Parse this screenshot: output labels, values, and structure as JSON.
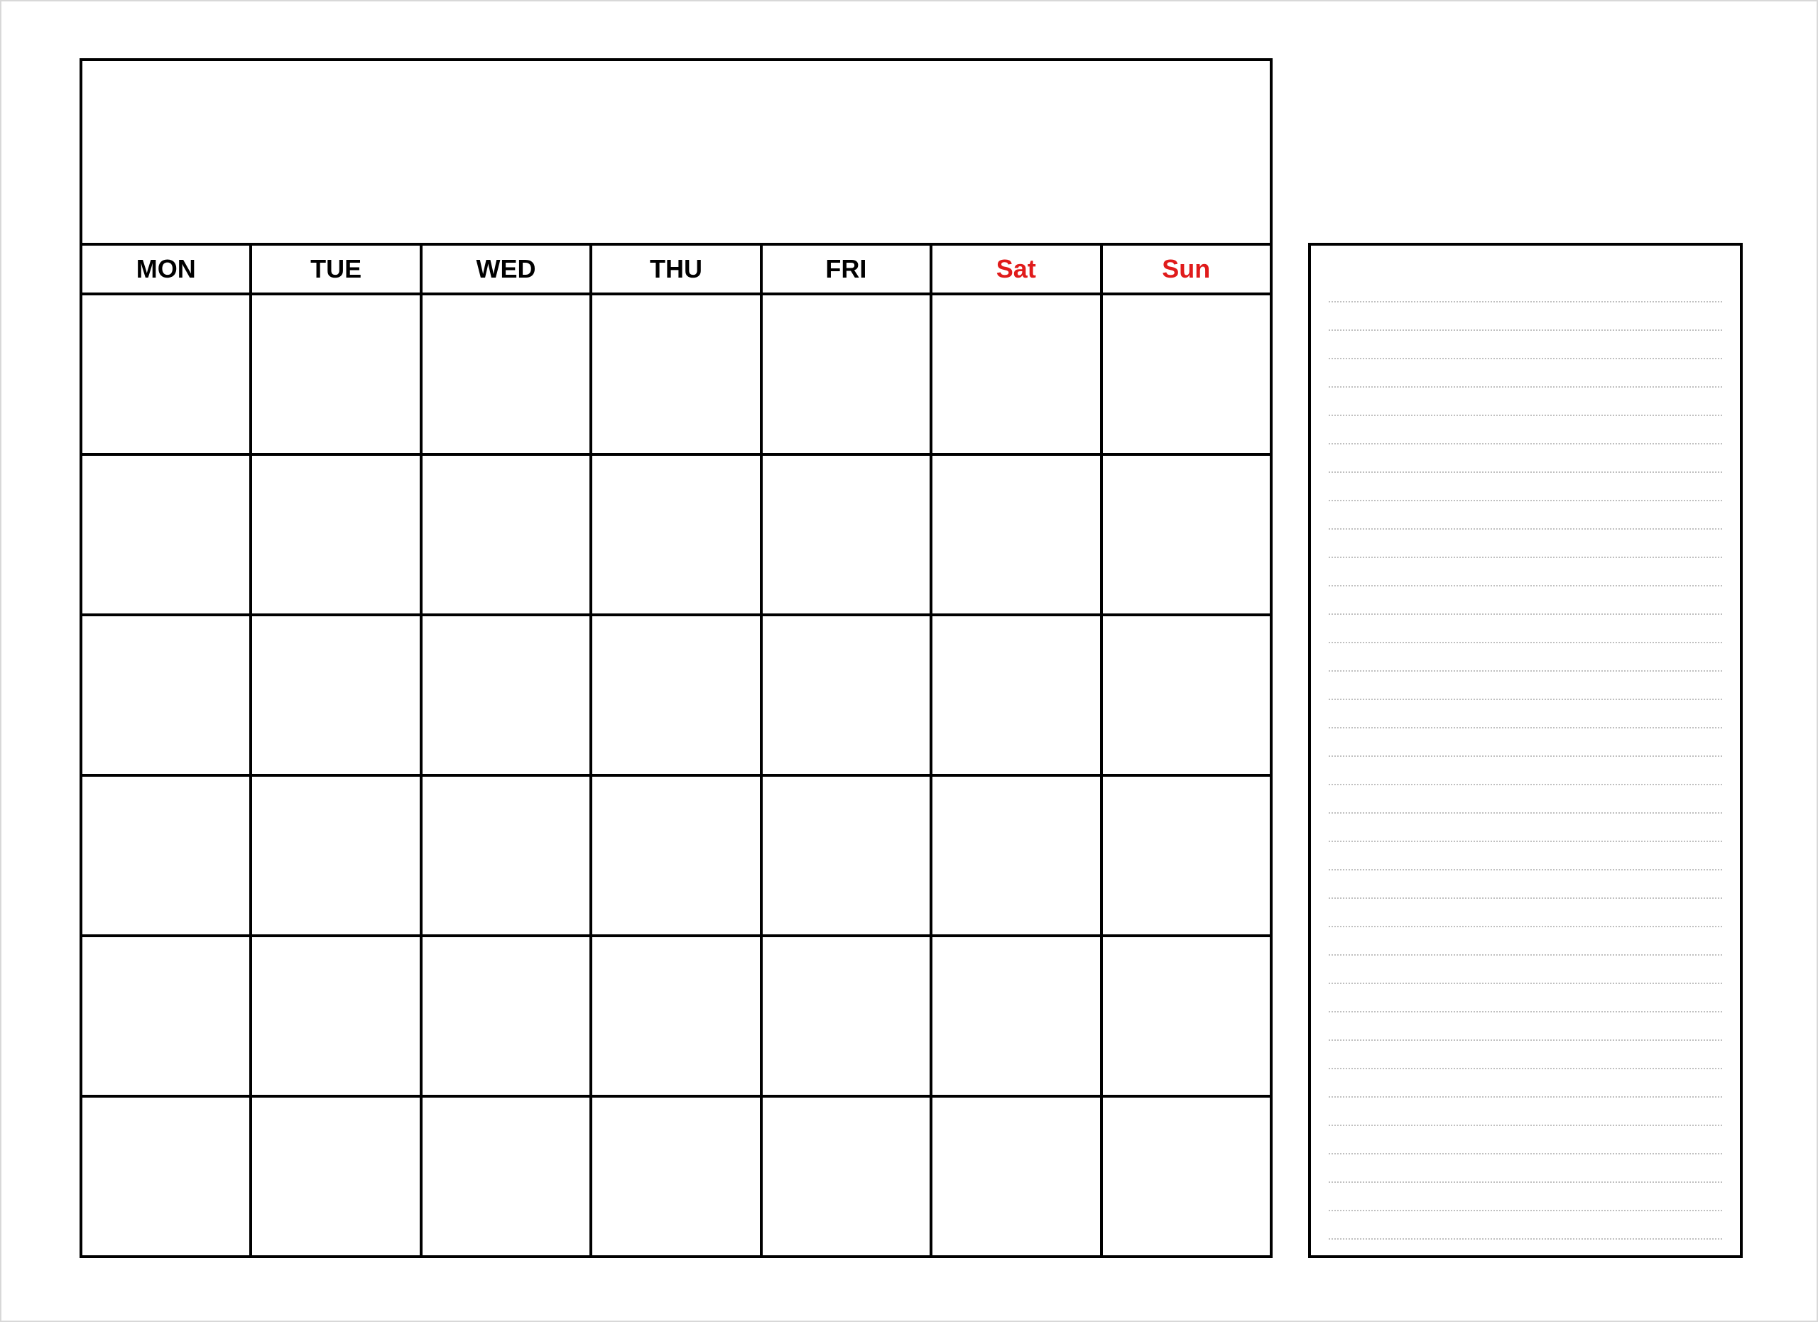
{
  "calendar": {
    "title": "",
    "days": [
      {
        "label": "MON",
        "weekend": false
      },
      {
        "label": "TUE",
        "weekend": false
      },
      {
        "label": "WED",
        "weekend": false
      },
      {
        "label": "THU",
        "weekend": false
      },
      {
        "label": "FRI",
        "weekend": false
      },
      {
        "label": "Sat",
        "weekend": true
      },
      {
        "label": "Sun",
        "weekend": true
      }
    ],
    "rows": 6
  },
  "notes": {
    "line_count": 34
  }
}
